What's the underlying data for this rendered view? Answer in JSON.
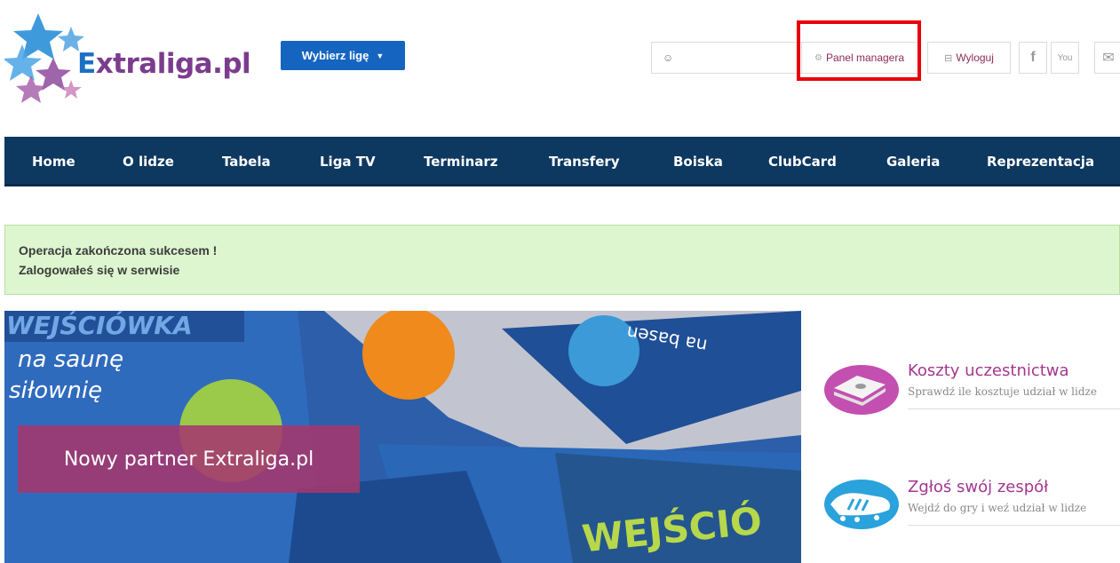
{
  "logo": {
    "text_prefix": "E",
    "text_rest": "xtraliga.pl"
  },
  "header": {
    "league_button": "Wybierz ligę",
    "user_field": "",
    "panel_link": "Panel managera",
    "logout_link": "Wyloguj",
    "social": [
      {
        "name": "facebook-icon",
        "glyph": "f"
      },
      {
        "name": "youtube-icon",
        "glyph": "You"
      },
      {
        "name": "mail-icon",
        "glyph": "✉"
      }
    ]
  },
  "nav": {
    "items": [
      "Home",
      "O lidze",
      "Tabela",
      "Liga TV",
      "Terminarz",
      "Transfery",
      "Boiska",
      "ClubCard",
      "Galeria",
      "Reprezentacja"
    ]
  },
  "alert": {
    "line1": "Operacja zakończona sukcesem !",
    "line2": "Zalogowałeś się w serwisie"
  },
  "banner": {
    "caption": "Nowy partner Extraliga.pl",
    "photo_text_1": "WEJŚCIÓWKA",
    "photo_text_2": "na saunę",
    "photo_text_3": "siłownię",
    "photo_text_4": "WEJŚCIÓ",
    "photo_text_5": "na basen"
  },
  "sidebar": {
    "cards": [
      {
        "title": "Koszty uczestnictwa",
        "subtitle": "Sprawdź ile kosztuje udział w lidze"
      },
      {
        "title": "Zgłoś swój zespół",
        "subtitle": "Wejdź do gry i weź udział w lidze"
      }
    ]
  },
  "colors": {
    "nav_bg": "#0d3860",
    "brand_purple": "#a3378f",
    "league_btn": "#1565c0",
    "alert_bg": "#ddf6cf",
    "highlight": "#e8000b"
  }
}
